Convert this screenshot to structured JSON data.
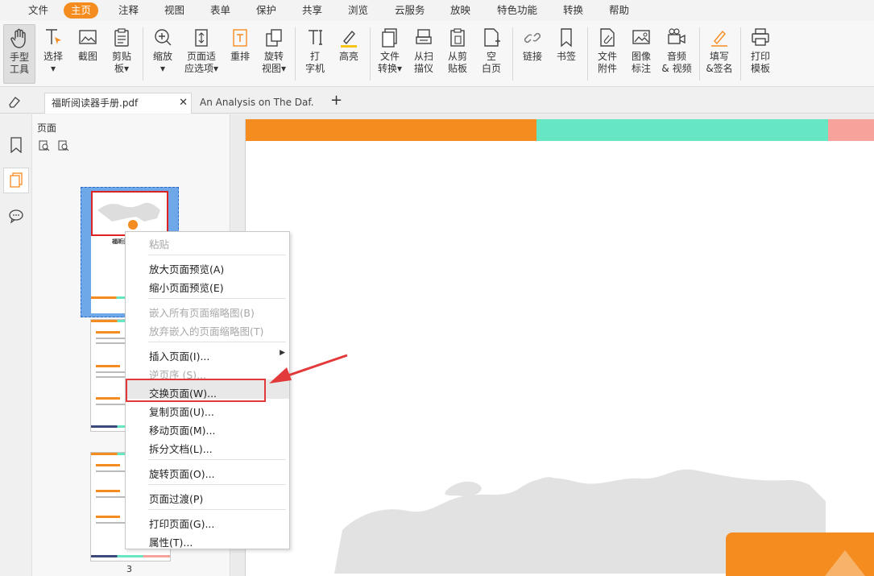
{
  "menu": {
    "items": [
      "文件",
      "主页",
      "注释",
      "视图",
      "表单",
      "保护",
      "共享",
      "浏览",
      "云服务",
      "放映",
      "特色功能",
      "转换",
      "帮助"
    ],
    "active": "主页"
  },
  "ribbon": {
    "tools": [
      {
        "id": "hand",
        "label": "手型\n工具"
      },
      {
        "id": "select",
        "label": "选择\n▾"
      },
      {
        "id": "snapshot",
        "label": "截图"
      },
      {
        "id": "clipboard",
        "label": "剪贴\n板▾"
      },
      {
        "id": "zoom",
        "label": "缩放\n▾"
      },
      {
        "id": "fit",
        "label": "页面适\n应选项▾"
      },
      {
        "id": "reflow",
        "label": "重排"
      },
      {
        "id": "rotate",
        "label": "旋转\n视图▾"
      },
      {
        "id": "typewriter",
        "label": "打\n字机"
      },
      {
        "id": "highlight",
        "label": "高亮"
      },
      {
        "id": "convert",
        "label": "文件\n转换▾"
      },
      {
        "id": "scan",
        "label": "从扫\n描仪"
      },
      {
        "id": "fromclip",
        "label": "从剪\n贴板"
      },
      {
        "id": "blank",
        "label": "空\n白页"
      },
      {
        "id": "link",
        "label": "链接"
      },
      {
        "id": "bookmark",
        "label": "书签"
      },
      {
        "id": "attach",
        "label": "文件\n附件"
      },
      {
        "id": "image",
        "label": "图像\n标注"
      },
      {
        "id": "media",
        "label": "音频\n& 视频"
      },
      {
        "id": "fillsign",
        "label": "填写\n&签名"
      },
      {
        "id": "print",
        "label": "打印\n模板"
      }
    ]
  },
  "tabs": [
    {
      "label": "福昕阅读器手册.pdf",
      "active": true
    },
    {
      "label": "An Analysis on The Daf...",
      "active": false
    }
  ],
  "panel": {
    "title": "页面",
    "page_number": "3",
    "thumb_text": "福昕阅"
  },
  "context_menu": {
    "items": [
      {
        "label": "粘贴",
        "disabled": true
      },
      {
        "label": "放大页面预览(A)",
        "disabled": false
      },
      {
        "label": "缩小页面预览(E)",
        "disabled": false
      },
      {
        "label": "嵌入所有页面缩略图(B)",
        "disabled": true
      },
      {
        "label": "放弃嵌入的页面缩略图(T)",
        "disabled": true
      },
      {
        "label": "插入页面(I)...",
        "disabled": false
      },
      {
        "label": "逆页序 (S)...",
        "disabled": true
      },
      {
        "label": "交换页面(W)...",
        "disabled": false
      },
      {
        "label": "复制页面(U)...",
        "disabled": false
      },
      {
        "label": "移动页面(M)...",
        "disabled": false
      },
      {
        "label": "拆分文档(L)...",
        "disabled": false
      },
      {
        "label": "旋转页面(O)...",
        "disabled": false
      },
      {
        "label": "页面过渡(P)",
        "disabled": false
      },
      {
        "label": "打印页面(G)...",
        "disabled": false
      },
      {
        "label": "属性(T)...",
        "disabled": false
      }
    ]
  },
  "colors": {
    "accent": "#f58c1f",
    "teal": "#66e6c2",
    "pink": "#f7a29b",
    "highlight_border": "#e23a3a"
  }
}
